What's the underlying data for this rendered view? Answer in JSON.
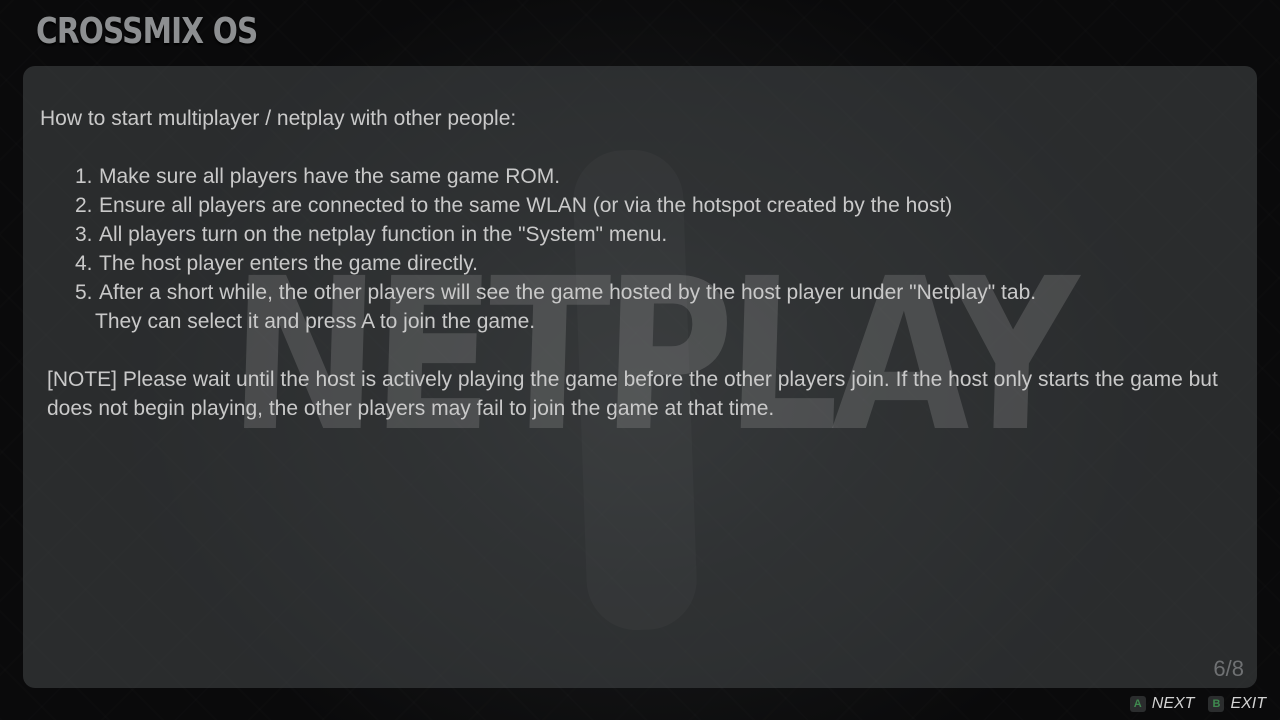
{
  "header": {
    "logo_text": "CROSSMIX OS"
  },
  "watermark": {
    "text": "NETPLAY"
  },
  "help": {
    "intro": "How to start multiplayer / netplay with other people:",
    "steps": [
      {
        "number": "1.",
        "text": "Make sure all players have the same game ROM."
      },
      {
        "number": "2.",
        "text": "Ensure all players are connected to the same WLAN (or via the hotspot created by the host)"
      },
      {
        "number": "3.",
        "text": "All players turn on the netplay function in the \"System\" menu."
      },
      {
        "number": "4.",
        "text": "The host player enters the game directly."
      },
      {
        "number": "5.",
        "text": "After a short while, the other players will see the game hosted by the host player under \"Netplay\" tab."
      }
    ],
    "step5_continued": "They can select it and press A to join the game.",
    "note": "[NOTE] Please wait until the host is actively playing the game before the other players join. If the host only starts the game but does not begin playing, the other players may fail to join the game at that time.",
    "page_indicator": "6/8"
  },
  "footer": {
    "next": {
      "button": "A",
      "label": "NEXT",
      "button_color": "#3f8a4f"
    },
    "exit": {
      "button": "B",
      "label": "EXIT",
      "button_color": "#3f8a4f"
    }
  }
}
